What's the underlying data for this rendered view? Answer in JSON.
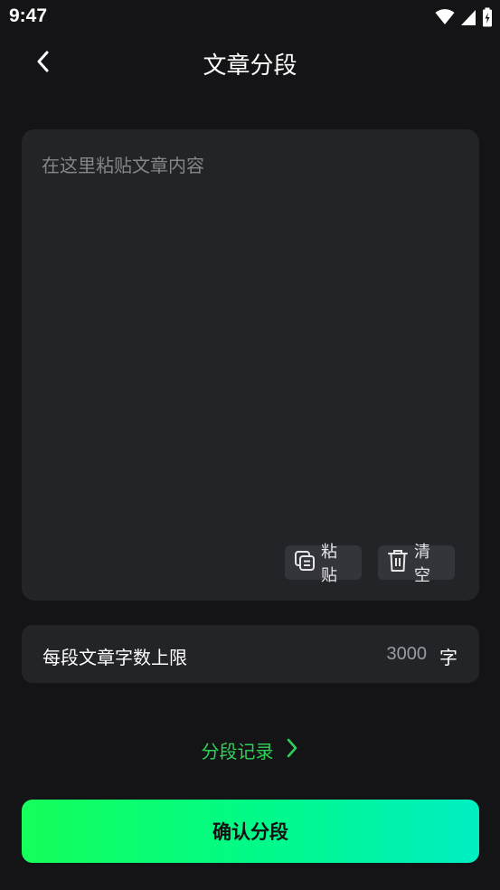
{
  "status_bar": {
    "time": "9:47",
    "icons": [
      "wifi-icon",
      "signal-icon",
      "battery-icon"
    ]
  },
  "header": {
    "title": "文章分段",
    "back_icon": "chevron-left-icon"
  },
  "editor": {
    "placeholder": "在这里粘贴文章内容",
    "value": "",
    "paste": {
      "label": "粘贴",
      "icon": "paste-icon"
    },
    "clear": {
      "label": "清空",
      "icon": "trash-icon"
    }
  },
  "limit": {
    "label": "每段文章字数上限",
    "value": "3000",
    "unit": "字"
  },
  "history": {
    "label": "分段记录",
    "icon": "chevron-right-icon"
  },
  "confirm": {
    "label": "确认分段"
  },
  "colors": {
    "background": "#141416",
    "card": "#232427",
    "accent_green": "#2fd158",
    "gradient_start": "#14ff5a",
    "gradient_end": "#00f0c4"
  }
}
